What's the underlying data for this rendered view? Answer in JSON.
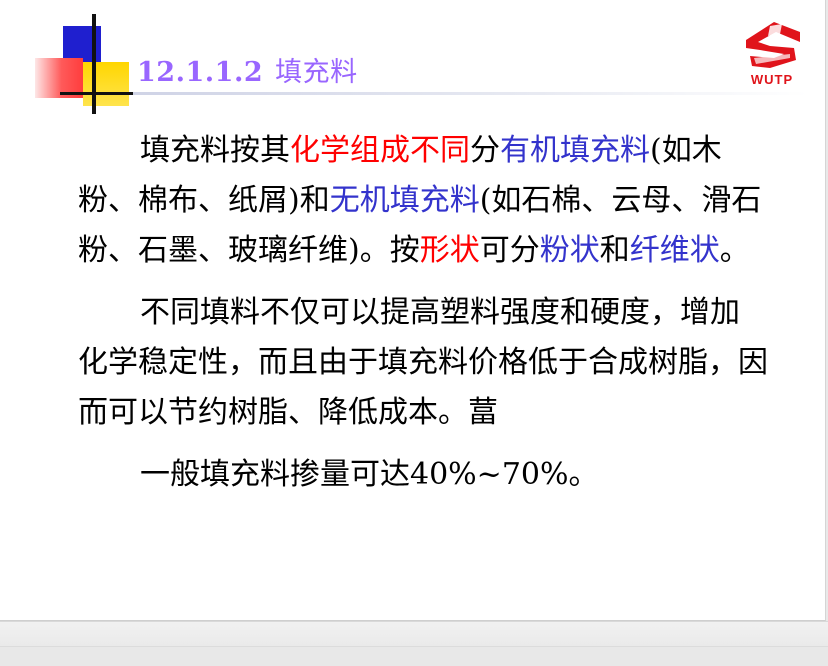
{
  "title": {
    "number": "12.1.1.2",
    "text": "填充料"
  },
  "logo": {
    "text": "WUTP"
  },
  "colors": {
    "title": "#9966ff",
    "red": "#ff0000",
    "blue": "#3333cc"
  },
  "paragraphs": {
    "p1": {
      "s1": "填充料按其",
      "s2": "化学组成不同",
      "s3": "分",
      "s4": "有机填充料",
      "s5": "(如木粉、棉布、纸屑)和",
      "s6": "无机填充料",
      "s7": "(如石棉、云母、滑石粉、石墨、玻璃纤维)。按",
      "s8": "形状",
      "s9": "可分",
      "s10": "粉状",
      "s11": "和",
      "s12": "纤维状",
      "s13": "。"
    },
    "p2": "不同填料不仅可以提高塑料强度和硬度，增加化学稳定性，而且由于填充料价格低于合成树脂，因而可以节约树脂、降低成本。葍",
    "p3": "一般填充料掺量可达40%~70%。"
  }
}
